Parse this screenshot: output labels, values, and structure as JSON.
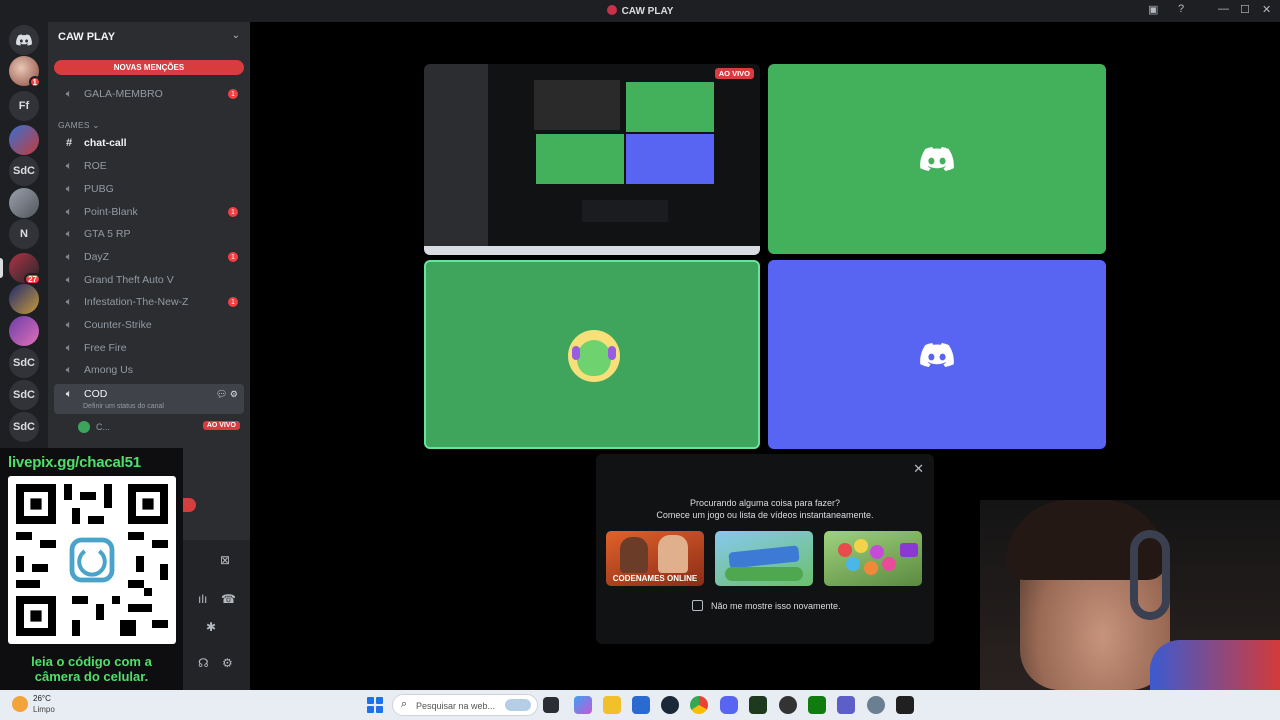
{
  "window": {
    "title": "CAW PLAY"
  },
  "guilds": {
    "items": [
      {
        "label": "",
        "badge": "1"
      },
      {
        "label": "Ff",
        "badge": ""
      },
      {
        "label": "",
        "badge": ""
      },
      {
        "label": "SdC",
        "badge": ""
      },
      {
        "label": "",
        "badge": ""
      },
      {
        "label": "N",
        "badge": ""
      },
      {
        "label": "",
        "badge": "27"
      },
      {
        "label": "",
        "badge": ""
      },
      {
        "label": "",
        "badge": ""
      },
      {
        "label": "SdC",
        "badge": ""
      },
      {
        "label": "SdC",
        "badge": ""
      },
      {
        "label": "SdC",
        "badge": ""
      }
    ]
  },
  "sidebar": {
    "server_name": "CAW PLAY",
    "new_mentions": "NOVAS MENÇÕES",
    "top_channel": {
      "name": "GALA-MEMBRO",
      "badge": "1"
    },
    "category": "GAMES",
    "channels": [
      {
        "name": "chat-call",
        "type": "text",
        "badge": ""
      },
      {
        "name": "ROE",
        "type": "voice",
        "badge": ""
      },
      {
        "name": "PUBG",
        "type": "voice",
        "badge": ""
      },
      {
        "name": "Point-Blank",
        "type": "voice",
        "badge": "1"
      },
      {
        "name": "GTA 5 RP",
        "type": "voice",
        "badge": ""
      },
      {
        "name": "DayZ",
        "type": "voice",
        "badge": "1"
      },
      {
        "name": "Grand Theft Auto V",
        "type": "voice",
        "badge": ""
      },
      {
        "name": "Infestation-The-New-Z",
        "type": "voice",
        "badge": "1"
      },
      {
        "name": "Counter-Strike",
        "type": "voice",
        "badge": ""
      },
      {
        "name": "Free Fire",
        "type": "voice",
        "badge": ""
      },
      {
        "name": "Among Us",
        "type": "voice",
        "badge": ""
      }
    ],
    "selected_channel": {
      "name": "COD",
      "status_placeholder": "Definir um status do canal"
    },
    "voice_user": {
      "name": "C...",
      "live": "AO VIVO"
    }
  },
  "overlay": {
    "url": "livepix.gg/chacal51",
    "caption_line1": "leia o código com a",
    "caption_line2": "câmera do celular."
  },
  "stage": {
    "live_badge": "AO VIVO"
  },
  "activity_prompt": {
    "line1": "Procurando alguma coisa para fazer?",
    "line2": "Comece um jogo ou lista de vídeos instantaneamente.",
    "games": [
      "CODENAMES ONLINE",
      "",
      ""
    ],
    "dont_show": "Não me mostre isso novamente."
  },
  "taskbar": {
    "temperature": "26°C",
    "condition": "Limpo",
    "search_placeholder": "Pesquisar na web..."
  },
  "colors": {
    "accent": "#5865f2",
    "green_tile": "#43b05c",
    "alert": "#d83c3e",
    "overlay_text": "#4ee06a"
  }
}
